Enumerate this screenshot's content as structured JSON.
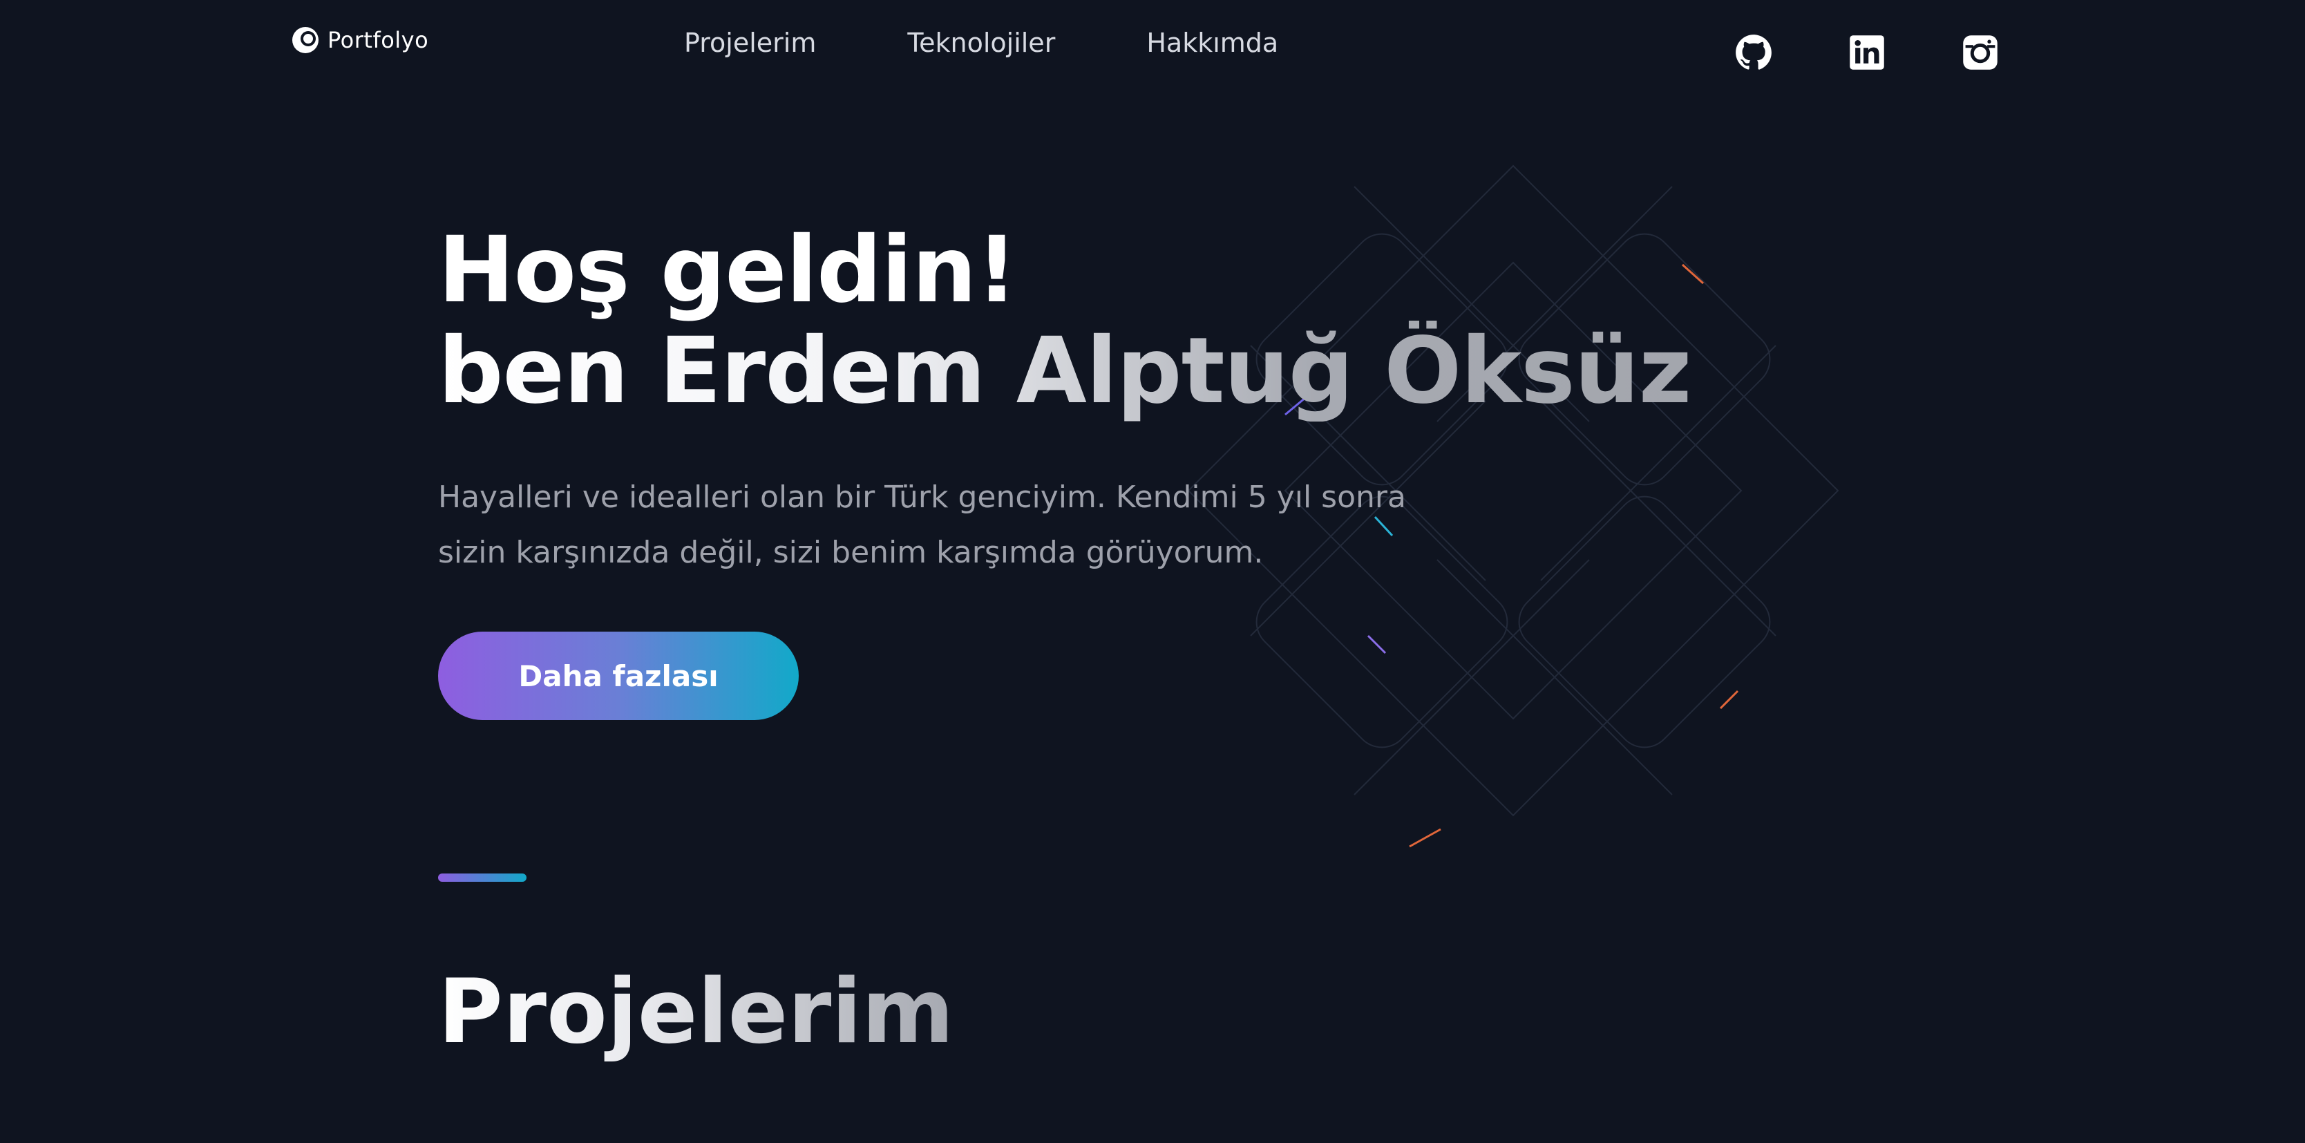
{
  "brand": {
    "name": "Portfolyo",
    "icon": "portfolyo-logo-icon"
  },
  "nav": {
    "items": [
      {
        "label": "Projelerim"
      },
      {
        "label": "Teknolojiler"
      },
      {
        "label": "Hakkımda"
      }
    ]
  },
  "socials": [
    {
      "name": "github-icon"
    },
    {
      "name": "linkedin-icon"
    },
    {
      "name": "instagram-icon"
    }
  ],
  "hero": {
    "line1": "Hoş geldin!",
    "line2": "ben Erdem Alptuğ Öksüz",
    "description": "Hayalleri ve idealleri olan bir Türk genciyim. Kendimi 5 yıl sonra sizin karşınızda değil, sizi benim karşımda görüyorum.",
    "cta_label": "Daha fazlası"
  },
  "projects": {
    "title": "Projelerim"
  },
  "colors": {
    "background": "#0f1420",
    "accent_purple": "#8e5ee0",
    "accent_cyan": "#12a9c9",
    "text_primary": "#ffffff",
    "text_muted": "#9ea1ab"
  }
}
